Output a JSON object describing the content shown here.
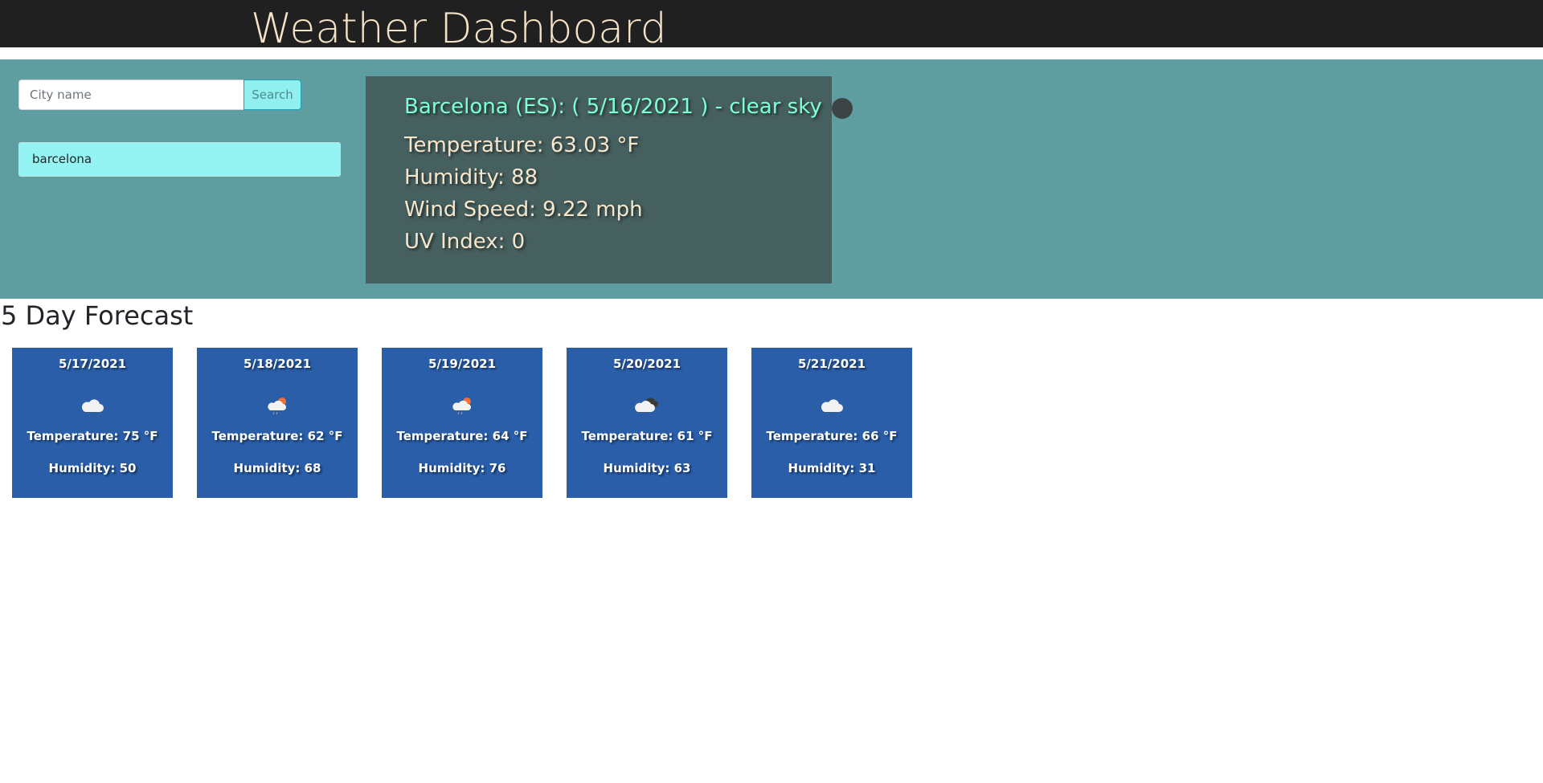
{
  "header": {
    "title": "Weather Dashboard"
  },
  "search": {
    "placeholder": "City name",
    "value": "",
    "button_label": "Search"
  },
  "history": {
    "items": [
      {
        "label": "barcelona"
      }
    ]
  },
  "current": {
    "heading": "Barcelona (ES): ( 5/16/2021 ) - clear sky",
    "icon": "weather-icon",
    "temperature": "Temperature: 63.03 °F",
    "humidity": "Humidity: 88",
    "wind": "Wind Speed: 9.22 mph",
    "uv": "UV Index: 0"
  },
  "forecast": {
    "title": "5 Day Forecast",
    "days": [
      {
        "date": "5/17/2021",
        "icon": "cloud-icon",
        "temperature": "Temperature: 75 °F",
        "humidity": "Humidity: 50"
      },
      {
        "date": "5/18/2021",
        "icon": "rain-sun-cloud-icon",
        "temperature": "Temperature: 62 °F",
        "humidity": "Humidity: 68"
      },
      {
        "date": "5/19/2021",
        "icon": "rain-sun-cloud-icon",
        "temperature": "Temperature: 64 °F",
        "humidity": "Humidity: 76"
      },
      {
        "date": "5/20/2021",
        "icon": "broken-clouds-icon",
        "temperature": "Temperature: 61 °F",
        "humidity": "Humidity: 63"
      },
      {
        "date": "5/21/2021",
        "icon": "cloud-icon",
        "temperature": "Temperature: 66 °F",
        "humidity": "Humidity: 31"
      }
    ]
  },
  "colors": {
    "header_bg": "#202020",
    "header_text": "#f5e3c8",
    "band_bg": "#5f9ea0",
    "card_bg": "#465f5f",
    "card_heading": "#7fffd4",
    "card_text": "#f5e6cc",
    "forecast_bg": "#2a5ea8"
  }
}
